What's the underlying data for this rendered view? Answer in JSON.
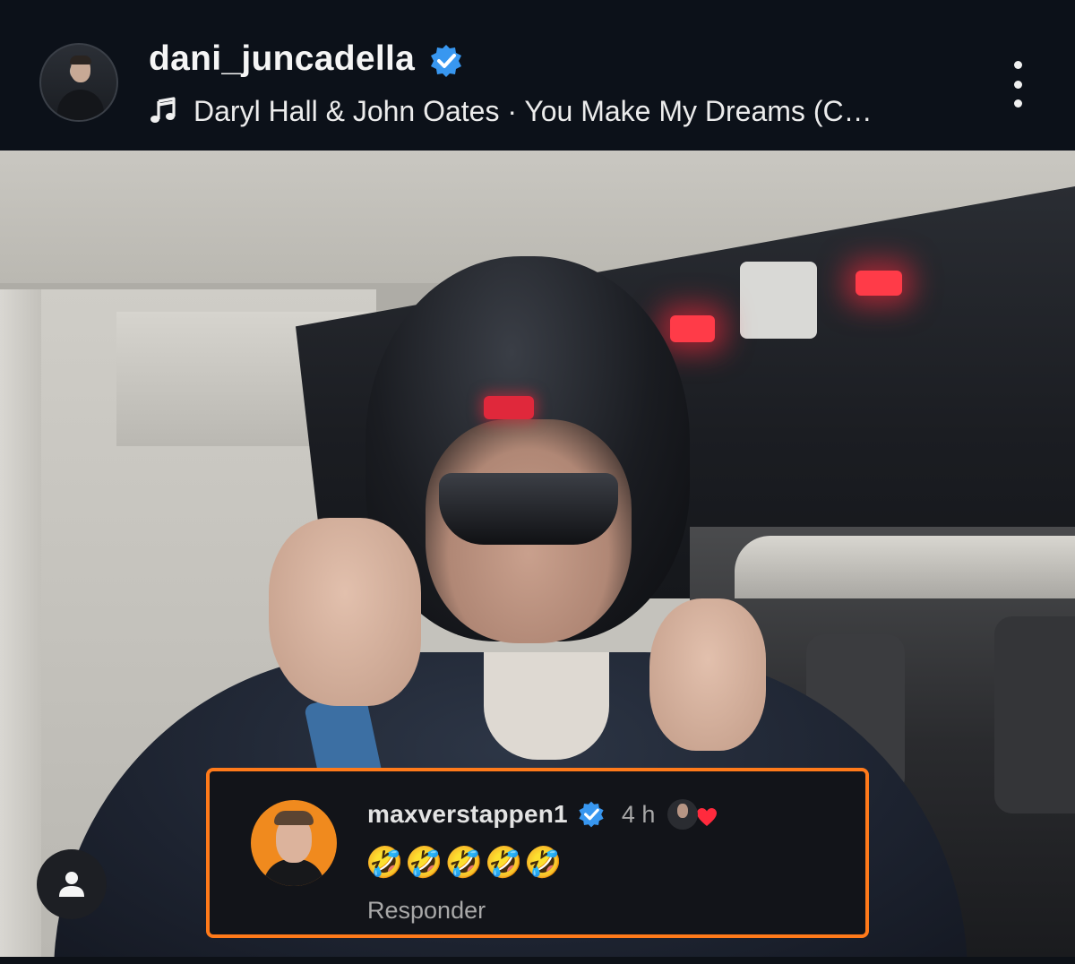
{
  "header": {
    "username": "dani_juncadella",
    "verified": true,
    "music_icon": "music-note-icon",
    "track": "Daryl Hall & John Oates · You Make My Dreams (C…",
    "menu_icon": "more-vertical-icon"
  },
  "comment": {
    "username": "maxverstappen1",
    "verified": true,
    "time": "4 h",
    "text": "🤣🤣🤣🤣🤣",
    "reply_label": "Responder",
    "liked_by_creator": true,
    "highlight_color": "#ff7a1a"
  },
  "colors": {
    "verified": "#3897f0",
    "heart": "#ff2a3d",
    "header_bg": "#0c1119"
  },
  "profile_chip_icon": "user-icon"
}
